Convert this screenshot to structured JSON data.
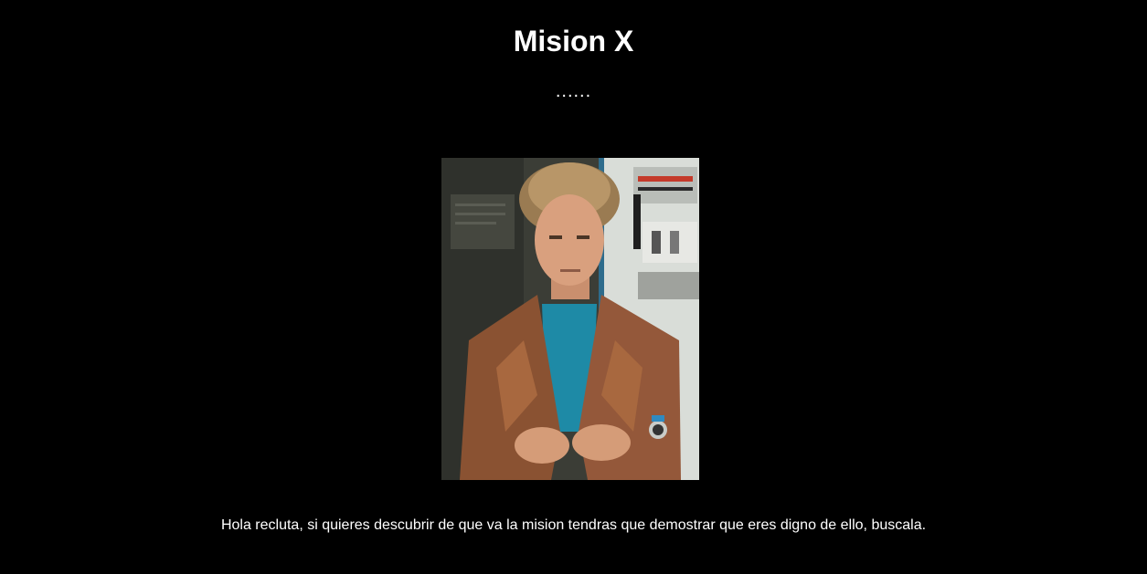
{
  "header": {
    "title": "Mision X",
    "subtitle": "......"
  },
  "image": {
    "subject": "man-in-leather-jacket-photo"
  },
  "message": {
    "text": "Hola recluta, si quieres descubrir de que va la mision tendras que demostrar que eres digno de ello, buscala."
  },
  "colors": {
    "background": "#000000",
    "text": "#ffffff"
  }
}
